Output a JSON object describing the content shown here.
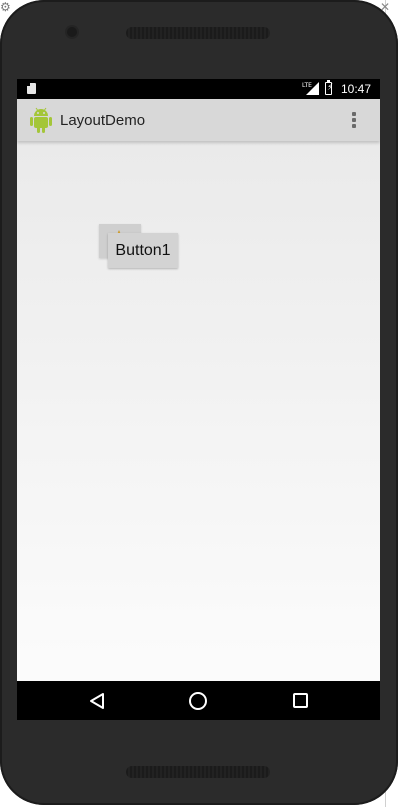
{
  "host": {
    "gear_icon": "gear-icon",
    "close_icon": "close-icon"
  },
  "status_bar": {
    "network": "LTE",
    "time": "10:47",
    "icons": [
      "sd-card-icon",
      "lte-signal-icon",
      "battery-charging-icon"
    ]
  },
  "action_bar": {
    "app_icon": "android-robot-icon",
    "title": "LayoutDemo",
    "menu_icon": "overflow-menu-icon"
  },
  "content": {
    "image_button_icon": "star-icon",
    "button1_label": "Button1"
  },
  "nav_bar": {
    "icons": [
      "back-icon",
      "home-icon",
      "recents-icon"
    ]
  },
  "colors": {
    "android_green": "#a4c639",
    "star_yellow": "#f5c533",
    "action_bar": "#d8d8d8"
  }
}
